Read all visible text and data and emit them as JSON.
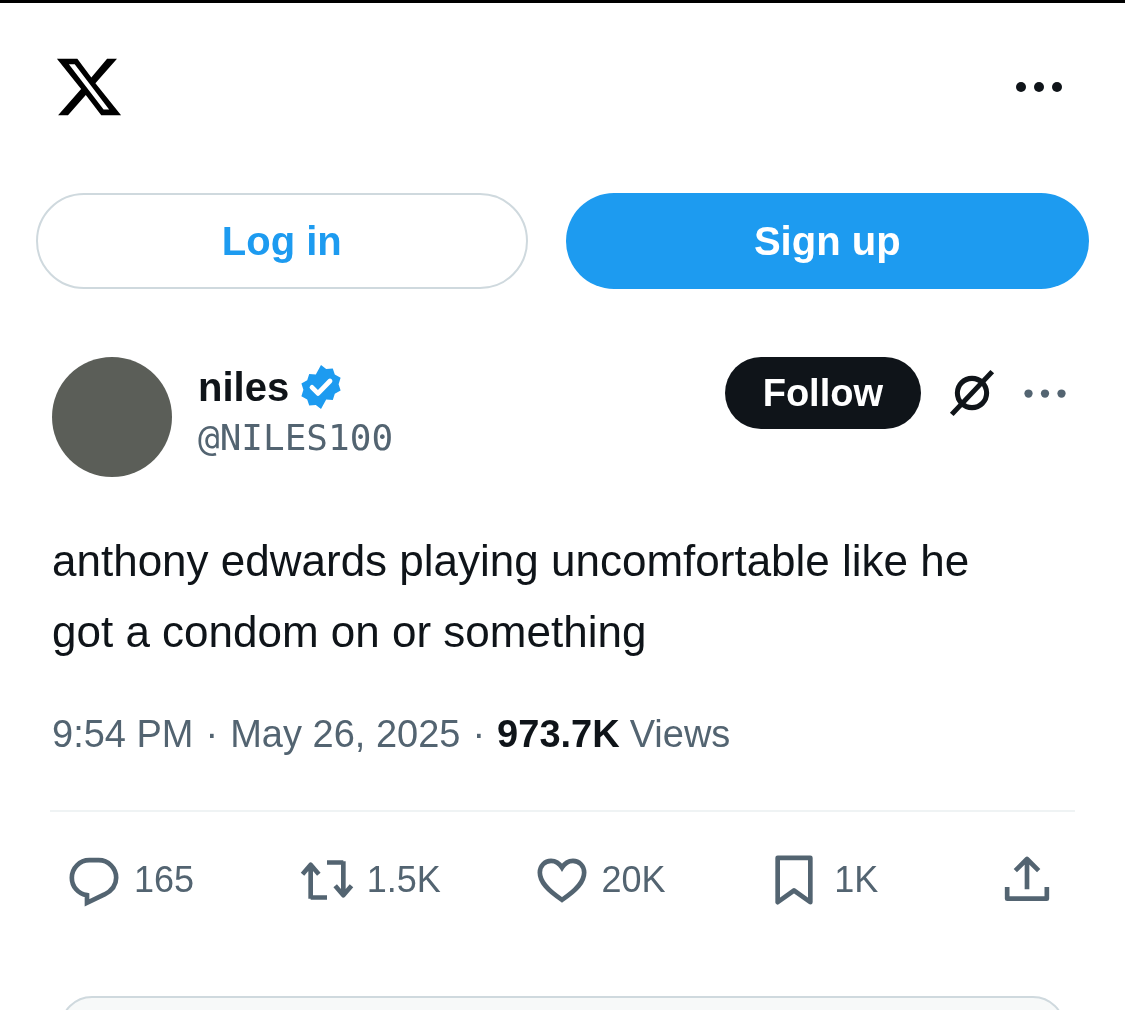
{
  "auth_buttons": [
    {
      "label": "Log in",
      "kind": "outline"
    },
    {
      "label": "Sign up",
      "kind": "filled"
    }
  ],
  "author": {
    "name": "niles",
    "verified": true,
    "handle": "@NILES100"
  },
  "follow_button": {
    "label": "Follow"
  },
  "tweet_text": "anthony edwards playing uncomfortable like he got a condom on or something",
  "meta": {
    "time": "9:54 PM",
    "separator": "·",
    "date": "May 26, 2025",
    "views_count": "973.7K",
    "views_label": "Views"
  },
  "actions": [
    {
      "kind": "reply",
      "count": "165"
    },
    {
      "kind": "repost",
      "count": "1.5K"
    },
    {
      "kind": "like",
      "count": "20K"
    },
    {
      "kind": "bookmark",
      "count": "1K"
    },
    {
      "kind": "share"
    }
  ]
}
